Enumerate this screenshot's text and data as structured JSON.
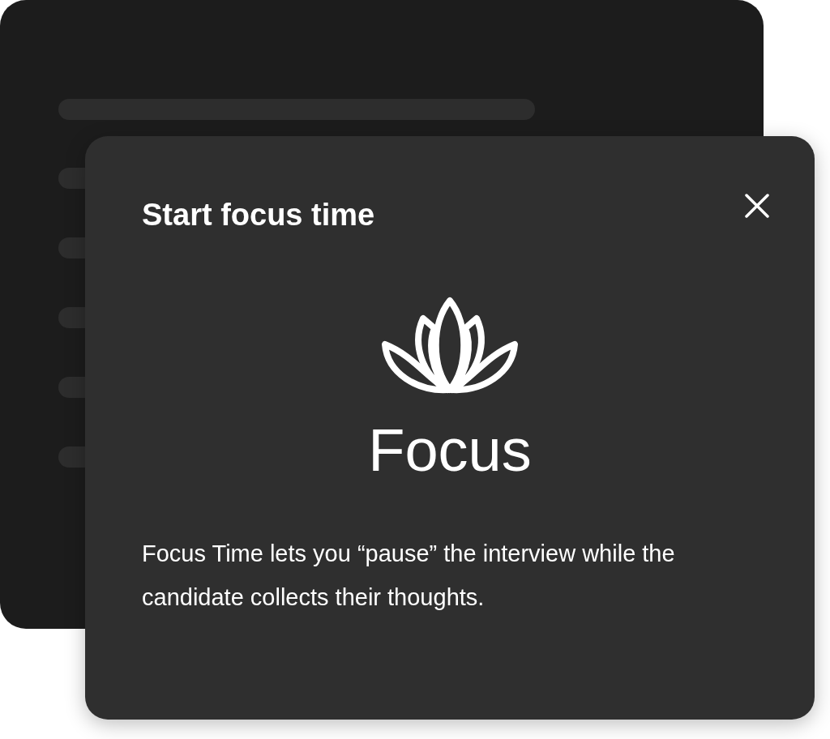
{
  "dialog": {
    "title": "Start focus time",
    "heading": "Focus",
    "description": "Focus Time lets you “pause” the interview while the candidate collects their thoughts."
  }
}
